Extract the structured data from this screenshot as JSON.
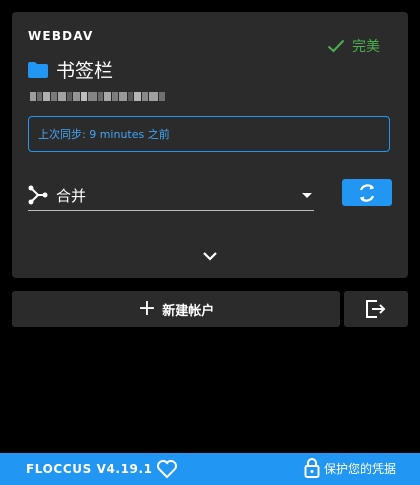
{
  "account": {
    "type": "WEBDAV",
    "status_label": "完美",
    "folder_name": "书签栏",
    "url_blurred": true,
    "last_sync": "上次同步: 9 minutes 之前",
    "strategy": "合并"
  },
  "actions": {
    "new_account": "新建帐户"
  },
  "footer": {
    "version": "FLOCCUS V4.19.1",
    "protect": "保护您的凭据"
  },
  "colors": {
    "accent": "#2196f3",
    "success": "#4caf50",
    "card": "#2b2b2b",
    "background": "#000000"
  },
  "icons": [
    "check-icon",
    "folder-icon",
    "merge-icon",
    "sync-icon",
    "chevron-down-icon",
    "plus-icon",
    "exit-icon",
    "heart-icon",
    "lock-icon"
  ]
}
